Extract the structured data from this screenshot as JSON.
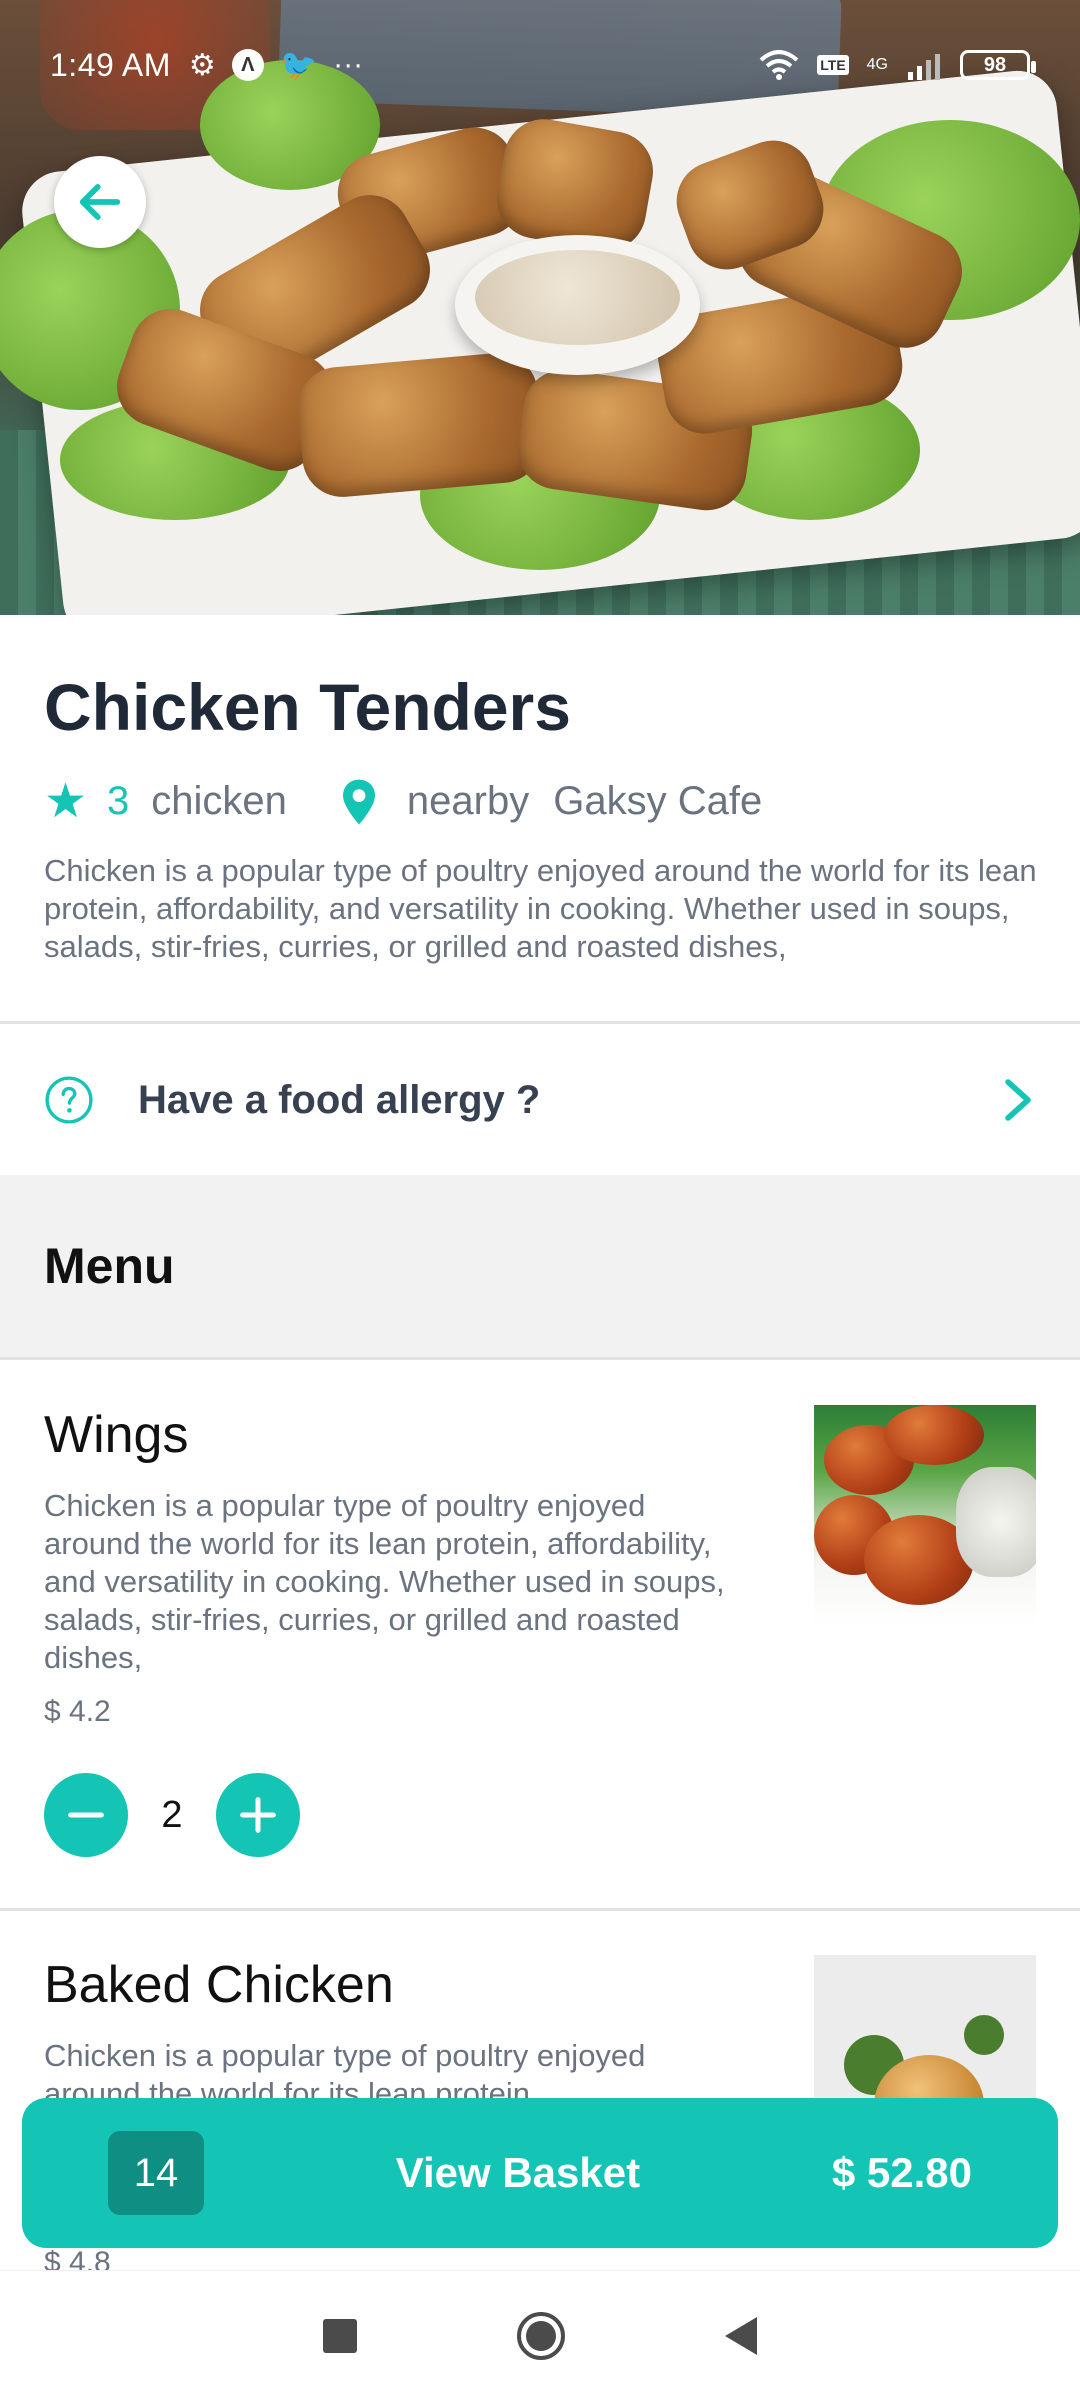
{
  "status_bar": {
    "time": "1:49 AM",
    "left_icons": [
      "gear-icon",
      "a-logo-icon",
      "twitter-icon",
      "more-dots-icon"
    ],
    "more": "···",
    "network_lte": "LTE",
    "network_4g": "4G",
    "battery": "98"
  },
  "restaurant": {
    "title": "Chicken Tenders",
    "rating": "3",
    "category": "chicken",
    "location_label": "nearby",
    "cafe": "Gaksy Cafe",
    "description": "Chicken is a popular type of poultry enjoyed around the world for its lean protein, affordability, and versatility in cooking. Whether used in soups, salads, stir-fries, curries, or grilled and roasted dishes,"
  },
  "allergy": {
    "label": "Have a food allergy ?"
  },
  "menu": {
    "header": "Menu",
    "items": [
      {
        "name": "Wings",
        "description": "Chicken is a popular type of poultry enjoyed around the world for its lean protein, affordability, and versatility in cooking. Whether used in soups, salads, stir-fries, curries, or grilled and roasted dishes,",
        "price": "$ 4.2",
        "quantity": "2"
      },
      {
        "name": "Baked Chicken",
        "description": "Chicken is a popular type of poultry enjoyed around the world for its lean protein,",
        "price": "$ 4.8"
      }
    ]
  },
  "basket": {
    "count": "14",
    "label": "View Basket",
    "total": "$ 52.80"
  },
  "colors": {
    "accent": "#14c4b4",
    "accent_dark": "#0f8f84",
    "title_text": "#1f2937",
    "muted_text": "#6b7280"
  }
}
